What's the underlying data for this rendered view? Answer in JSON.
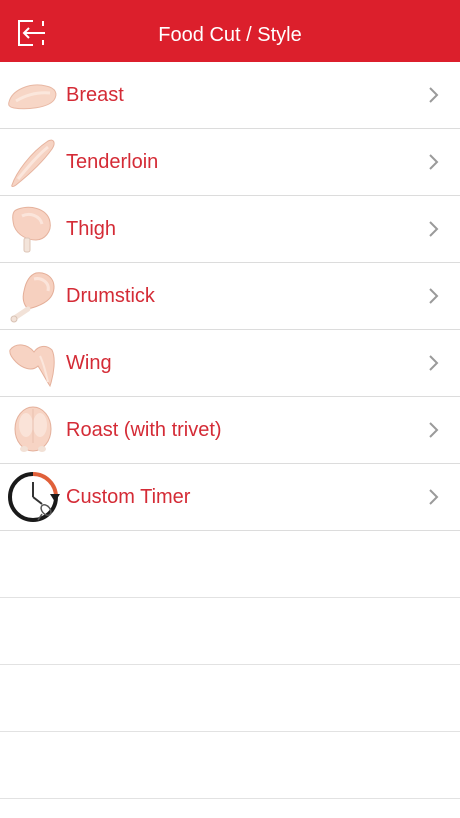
{
  "header": {
    "title": "Food Cut / Style",
    "back_icon": "back-exit-icon",
    "background": "#dc1f2c"
  },
  "list": {
    "items": [
      {
        "label": "Breast",
        "icon": "chicken-breast-icon"
      },
      {
        "label": "Tenderloin",
        "icon": "chicken-tenderloin-icon"
      },
      {
        "label": "Thigh",
        "icon": "chicken-thigh-icon"
      },
      {
        "label": "Drumstick",
        "icon": "chicken-drumstick-icon"
      },
      {
        "label": "Wing",
        "icon": "chicken-wing-icon"
      },
      {
        "label": "Roast (with trivet)",
        "icon": "whole-chicken-roast-icon"
      },
      {
        "label": "Custom Timer",
        "icon": "custom-timer-icon"
      }
    ],
    "label_color": "#d42b36",
    "chevron_icon": "chevron-right-icon"
  }
}
